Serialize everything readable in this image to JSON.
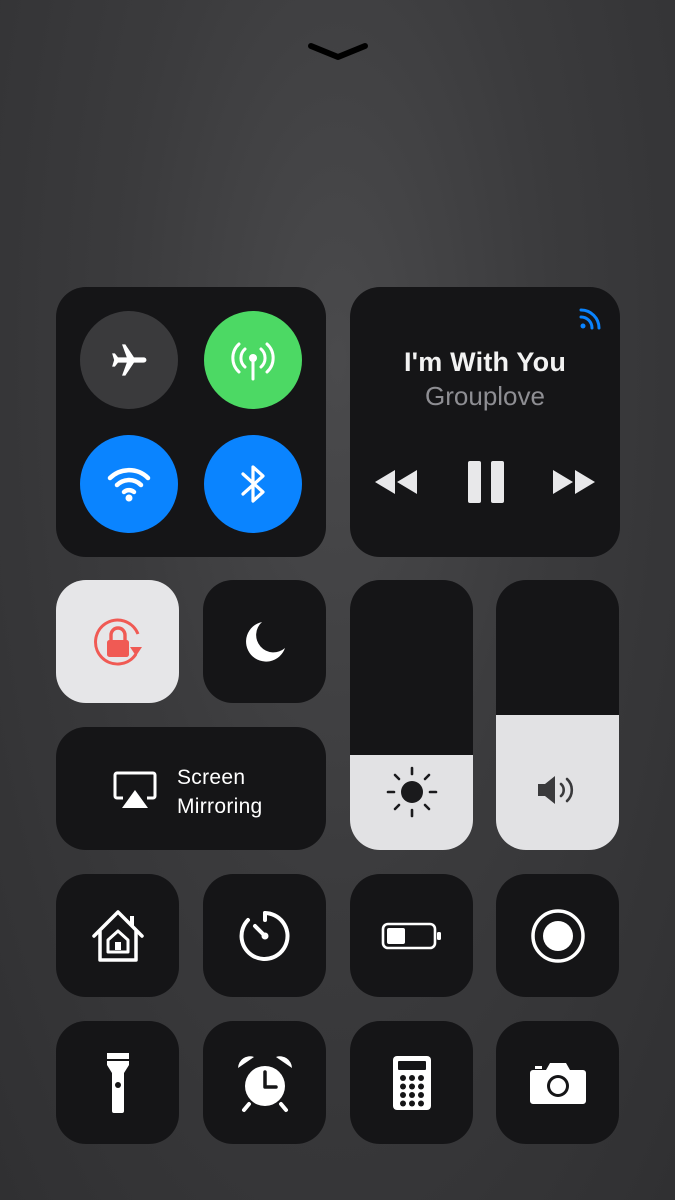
{
  "control_center": {
    "dismiss_handle": "chevron-down",
    "connectivity": {
      "airplane_mode": {
        "icon": "airplane-icon",
        "on": false,
        "color": "#3a3a3c"
      },
      "cellular_data": {
        "icon": "cellular-antenna-icon",
        "on": true,
        "color": "#4cd964"
      },
      "wifi": {
        "icon": "wifi-icon",
        "on": true,
        "color": "#0a84ff"
      },
      "bluetooth": {
        "icon": "bluetooth-icon",
        "on": true,
        "color": "#0a84ff"
      }
    },
    "now_playing": {
      "title": "I'm With You",
      "artist": "Grouplove",
      "airplay_icon_color": "#0a84ff",
      "controls": [
        "rewind-icon",
        "pause-icon",
        "fast-forward-icon"
      ]
    },
    "orientation_lock": {
      "icon": "rotation-lock-icon",
      "on": true,
      "accent": "#ff3b30"
    },
    "do_not_disturb": {
      "icon": "moon-icon",
      "on": false
    },
    "screen_mirroring": {
      "label_line1": "Screen",
      "label_line2": "Mirroring",
      "icon": "airplay-screen-icon"
    },
    "brightness": {
      "icon": "sun-icon",
      "level": 0.35
    },
    "volume": {
      "icon": "speaker-icon",
      "level": 0.5
    },
    "row_three": [
      "home-icon",
      "timer-icon",
      "low-power-battery-icon",
      "screen-record-icon"
    ],
    "row_four": [
      "flashlight-icon",
      "alarm-clock-icon",
      "calculator-icon",
      "camera-icon"
    ]
  }
}
